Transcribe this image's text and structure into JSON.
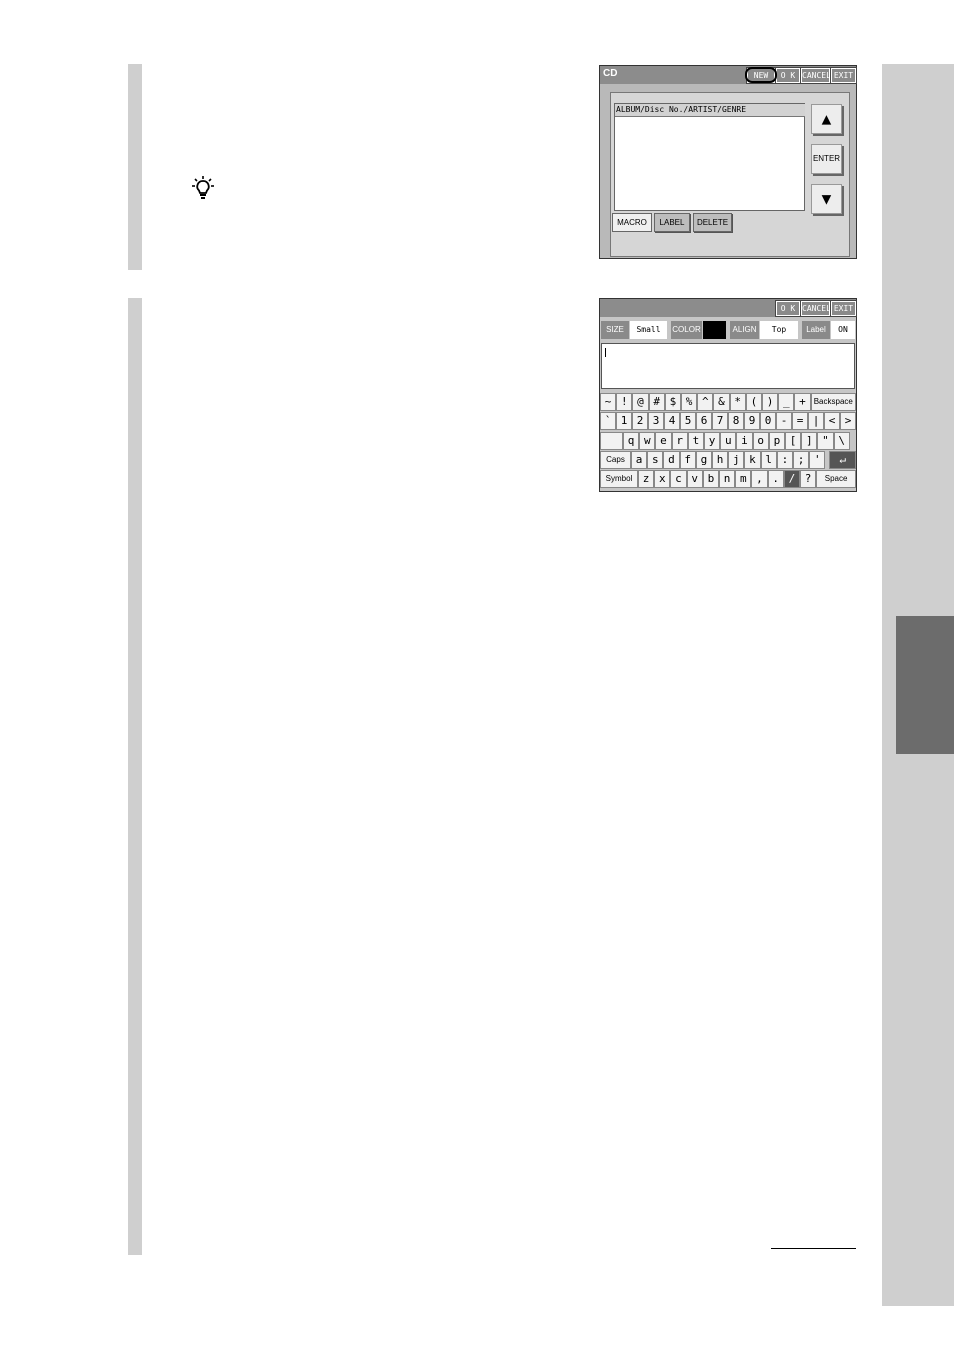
{
  "screen1": {
    "title": "CD",
    "toolbar": {
      "new": "NEW",
      "ok": "O K",
      "cancel": "CANCEL",
      "exit": "EXIT"
    },
    "list_header": "ALBUM/Disc No./ARTIST/GENRE",
    "side_buttons": {
      "up": "▲",
      "enter": "ENTER",
      "down": "▼"
    },
    "tabs": {
      "macro": "MACRO",
      "label": "LABEL",
      "delete": "DELETE"
    }
  },
  "screen2": {
    "toolbar": {
      "ok": "O K",
      "cancel": "CANCEL",
      "exit": "EXIT"
    },
    "options": {
      "size_label": "SIZE",
      "size_value": "Small",
      "color_label": "COLOR",
      "color_value": "#000000",
      "align_label": "ALIGN",
      "align_value": "Top left",
      "label_label": "Label",
      "label_value": "ON"
    },
    "keyboard": {
      "row1": [
        "~",
        "!",
        "@",
        "#",
        "$",
        "%",
        "^",
        "&",
        "*",
        "(",
        ")",
        "_",
        "+"
      ],
      "row1_end": "Backspace",
      "row2": [
        "`",
        "1",
        "2",
        "3",
        "4",
        "5",
        "6",
        "7",
        "8",
        "9",
        "0",
        "-",
        "=",
        "|",
        "<",
        ">"
      ],
      "row3": [
        "q",
        "w",
        "e",
        "r",
        "t",
        "y",
        "u",
        "i",
        "o",
        "p",
        "[",
        "]",
        "\"",
        "\\"
      ],
      "row4_start": "Caps Lock",
      "row4": [
        "a",
        "s",
        "d",
        "f",
        "g",
        "h",
        "j",
        "k",
        "l",
        ":",
        ";",
        "'"
      ],
      "row4_end": "↵",
      "row5_start": "Symbol",
      "row5": [
        "z",
        "x",
        "c",
        "v",
        "b",
        "n",
        "m",
        ",",
        ".",
        "/",
        "?"
      ],
      "row5_end": "Space"
    }
  },
  "icons": {
    "tip": "lightbulb-icon"
  }
}
